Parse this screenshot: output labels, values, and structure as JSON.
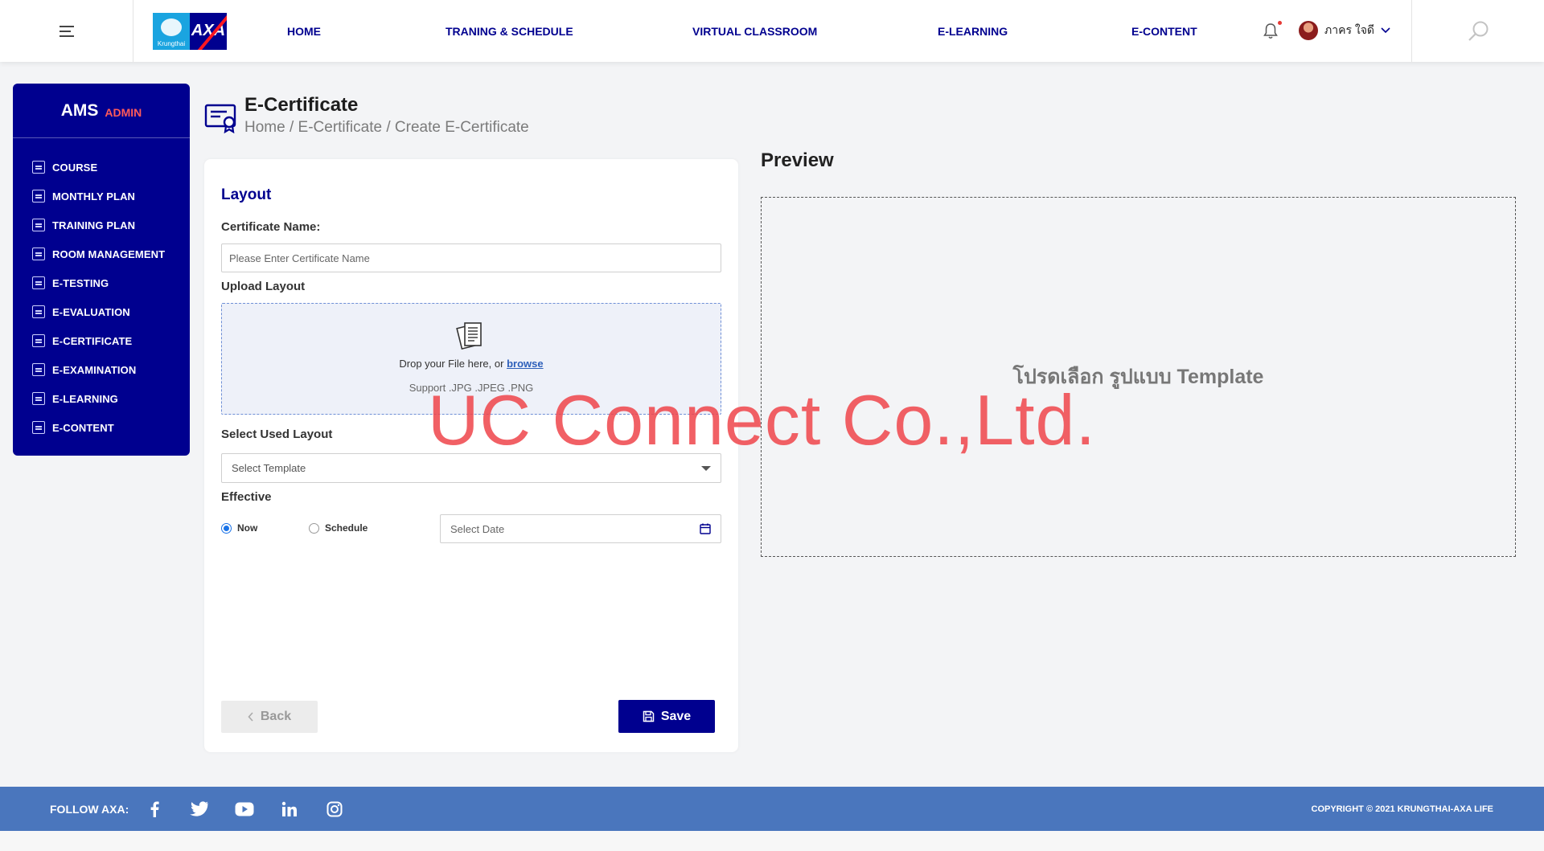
{
  "header": {
    "nav": [
      {
        "label": "HOME",
        "key": "home"
      },
      {
        "label": "TRANING & SCHEDULE",
        "key": "training-schedule"
      },
      {
        "label": "VIRTUAL CLASSROOM",
        "key": "virtual-classroom"
      },
      {
        "label": "E-LEARNING",
        "key": "e-learning"
      },
      {
        "label": "E-CONTENT",
        "key": "e-content"
      }
    ],
    "logo_small_text": "Krungthai",
    "logo_axa_text": "AXA",
    "user_name": "ภาคร ใจดี",
    "brand_colors": {
      "primary": "#00008f",
      "accent": "#ff1721",
      "ktb": "#1aa4e0"
    }
  },
  "sidebar": {
    "title": "AMS",
    "subtitle": "ADMIN",
    "items": [
      {
        "label": "COURSE",
        "icon": "book-icon"
      },
      {
        "label": "MONTHLY PLAN",
        "icon": "calendar-icon"
      },
      {
        "label": "TRAINING PLAN",
        "icon": "plan-icon"
      },
      {
        "label": "ROOM MANAGEMENT",
        "icon": "room-icon"
      },
      {
        "label": "E-TESTING",
        "icon": "test-icon"
      },
      {
        "label": "E-EVALUATION",
        "icon": "evaluation-icon"
      },
      {
        "label": "E-CERTIFICATE",
        "icon": "certificate-icon"
      },
      {
        "label": "E-EXAMINATION",
        "icon": "examination-icon"
      },
      {
        "label": "E-LEARNING",
        "icon": "monitor-icon"
      },
      {
        "label": "E-CONTENT",
        "icon": "content-icon"
      }
    ]
  },
  "page": {
    "title": "E-Certificate",
    "breadcrumb": [
      "Home",
      "E-Certificate",
      "Create E-Certificate"
    ]
  },
  "form": {
    "section_title": "Layout",
    "cert_name_label": "Certificate Name:",
    "cert_name_placeholder": "Please Enter Certificate Name",
    "cert_name_value": "",
    "upload_label": "Upload Layout",
    "drop_text": "Drop your File here, or",
    "browse_text": "browse",
    "support_text": "Support .JPG .JPEG .PNG",
    "select_layout_label": "Select Used Layout",
    "select_placeholder": "Select Template",
    "effective_label": "Effective",
    "radio_now": "Now",
    "radio_schedule": "Schedule",
    "effective_selected": "now",
    "date_placeholder": "Select Date",
    "back_label": "Back",
    "save_label": "Save"
  },
  "preview": {
    "title": "Preview",
    "message": "โปรดเลือก รูปแบบ Template"
  },
  "watermark": "UC Connect Co.,Ltd.",
  "footer": {
    "follow_label": "FOLLOW AXA:",
    "socials": [
      "facebook-icon",
      "twitter-icon",
      "youtube-icon",
      "linkedin-icon",
      "instagram-icon"
    ],
    "copyright": "COPYRIGHT © 2021 KRUNGTHAI-AXA LIFE"
  }
}
